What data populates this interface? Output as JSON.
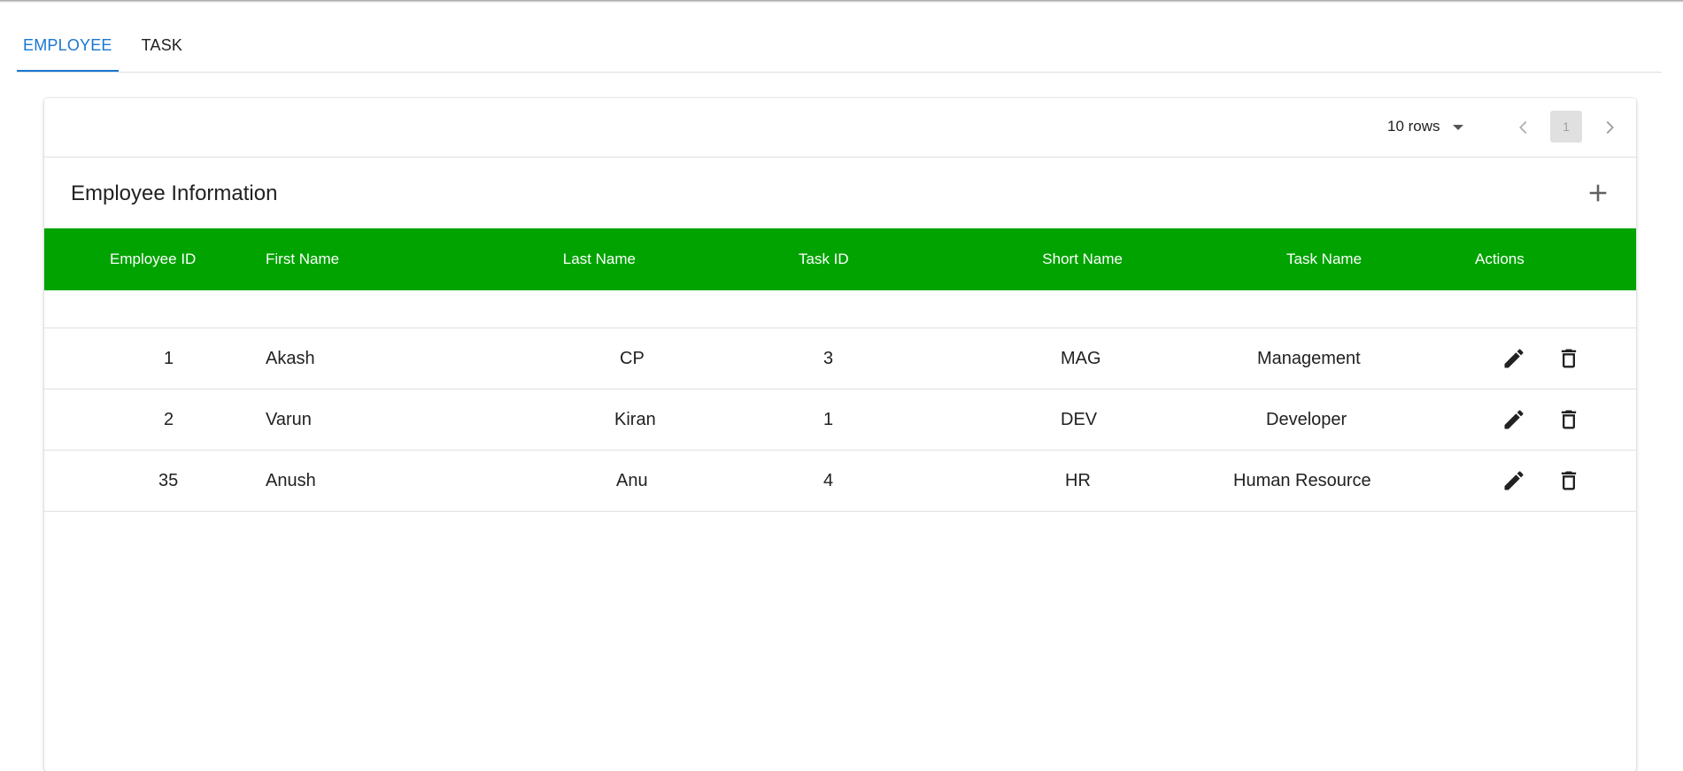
{
  "tabs": [
    {
      "label": "EMPLOYEE",
      "active": true
    },
    {
      "label": "TASK",
      "active": false
    }
  ],
  "toolbar": {
    "rows_per_page": "10 rows",
    "current_page": "1"
  },
  "table_title": "Employee Information",
  "columns": [
    "Employee ID",
    "First Name",
    "Last Name",
    "Task ID",
    "Short Name",
    "Task Name",
    "Actions"
  ],
  "rows": [
    {
      "employee_id": "1",
      "first_name": "Akash",
      "last_name": "CP",
      "task_id": "3",
      "short_name": "MAG",
      "task_name": "Management"
    },
    {
      "employee_id": "2",
      "first_name": "Varun",
      "last_name": "Kiran",
      "task_id": "1",
      "short_name": "DEV",
      "task_name": "Developer"
    },
    {
      "employee_id": "35",
      "first_name": "Anush",
      "last_name": "Anu",
      "task_id": "4",
      "short_name": "HR",
      "task_name": "Human Resource"
    }
  ],
  "icons": {
    "add": "plus-icon",
    "edit": "pencil-icon",
    "delete": "trash-icon",
    "prev": "chevron-left-icon",
    "next": "chevron-right-icon",
    "dropdown": "caret-down-icon"
  },
  "colors": {
    "header_bg": "#00a300",
    "active_tab": "#1976d2"
  }
}
